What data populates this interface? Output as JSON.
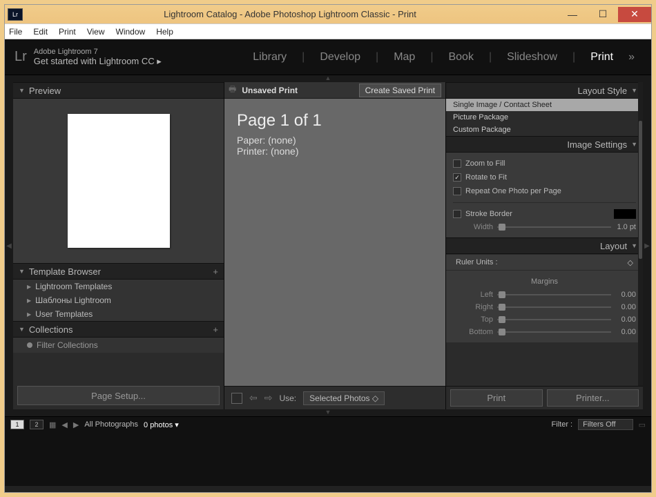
{
  "window": {
    "title": "Lightroom Catalog - Adobe Photoshop Lightroom Classic - Print",
    "app_badge": "Lr"
  },
  "menubar": [
    "File",
    "Edit",
    "Print",
    "View",
    "Window",
    "Help"
  ],
  "topbar": {
    "logo": "Lr",
    "line1": "Adobe Lightroom 7",
    "line2": "Get started with Lightroom CC ▸",
    "modules": [
      "Library",
      "Develop",
      "Map",
      "Book",
      "Slideshow",
      "Print"
    ],
    "active": "Print",
    "more": "»"
  },
  "left": {
    "preview_header": "Preview",
    "template_header": "Template Browser",
    "templates": [
      "Lightroom Templates",
      "Шаблоны Lightroom",
      "User Templates"
    ],
    "collections_header": "Collections",
    "filter_placeholder": "Filter Collections",
    "page_setup_btn": "Page Setup..."
  },
  "center": {
    "print_icon": "🖶",
    "unsaved": "Unsaved Print",
    "create_saved": "Create Saved Print",
    "page_text": "Page 1 of 1",
    "paper_text": "Paper: (none)",
    "printer_text": "Printer: (none)",
    "use_label": "Use:",
    "use_value": "Selected Photos",
    "arrow_left": "⇦",
    "arrow_right": "⇨"
  },
  "right": {
    "layout_style_header": "Layout Style",
    "layout_styles": [
      "Single Image / Contact Sheet",
      "Picture Package",
      "Custom Package"
    ],
    "image_settings_header": "Image Settings",
    "zoom_fill": "Zoom to Fill",
    "rotate_fit": "Rotate to Fit",
    "repeat_photo": "Repeat One Photo per Page",
    "stroke_border": "Stroke Border",
    "width_label": "Width",
    "width_val": "1.0 pt",
    "layout_header": "Layout",
    "ruler_label": "Ruler Units :",
    "margins_label": "Margins",
    "margins": [
      {
        "name": "Left",
        "val": "0.00"
      },
      {
        "name": "Right",
        "val": "0.00"
      },
      {
        "name": "Top",
        "val": "0.00"
      },
      {
        "name": "Bottom",
        "val": "0.00"
      }
    ],
    "print_btn": "Print",
    "printer_btn": "Printer..."
  },
  "filmstrip": {
    "grid1": "1",
    "grid2": "2",
    "source": "All Photographs",
    "count": "0 photos ▾",
    "filter_label": "Filter :",
    "filter_value": "Filters Off"
  }
}
